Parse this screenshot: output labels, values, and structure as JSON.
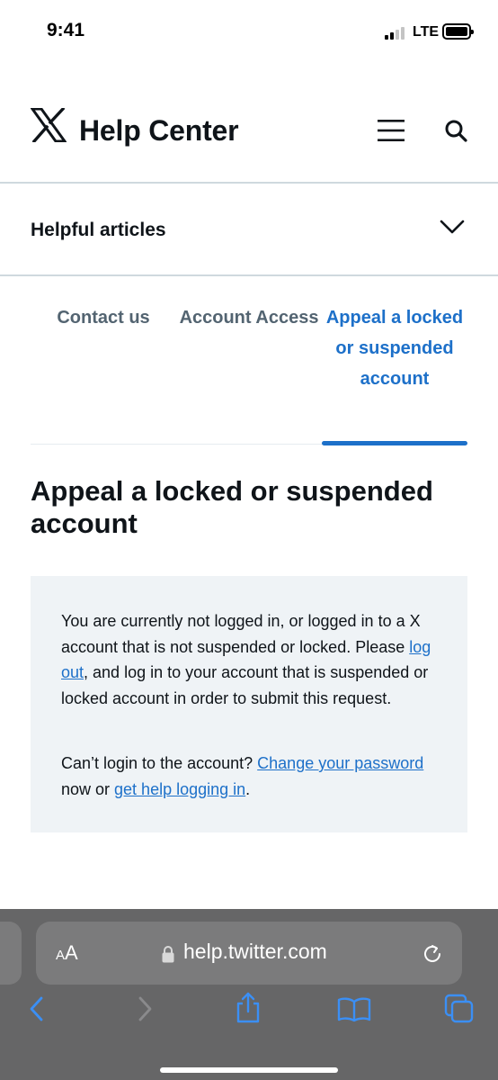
{
  "status_bar": {
    "time": "9:41",
    "carrier": "LTE"
  },
  "header": {
    "title": "Help Center",
    "logo_icon": "x-logo-icon",
    "menu_icon": "hamburger-menu-icon",
    "search_icon": "search-icon"
  },
  "helpful_articles": {
    "label": "Helpful articles",
    "icon": "chevron-down-icon"
  },
  "breadcrumbs": [
    {
      "label": "Contact us",
      "active": false
    },
    {
      "label": "Account Access",
      "active": false
    },
    {
      "label": "Appeal a locked or suspended account",
      "active": true
    }
  ],
  "page": {
    "title": "Appeal a locked or suspended account"
  },
  "notice": {
    "p1_before": "You are currently not logged in, or logged in to a X account that is not suspended or locked. Please ",
    "p1_link": "log out",
    "p1_after": ", and log in to your account that is suspended or locked account in order to submit this request.",
    "p2_before": "Can’t login to the account? ",
    "p2_link1": "Change your password",
    "p2_mid": " now or ",
    "p2_link2": "get help logging in",
    "p2_after": "."
  },
  "browser": {
    "aa_label_small": "A",
    "aa_label_large": "A",
    "url": "help.twitter.com",
    "toolbar_icons": [
      "back-icon",
      "forward-icon",
      "share-icon",
      "bookmarks-icon",
      "tabs-icon"
    ]
  },
  "colors": {
    "link": "#1d70c9",
    "text": "#0f1419",
    "muted": "#536471",
    "notice_bg": "#eff3f6",
    "browser_bg": "#666667"
  }
}
